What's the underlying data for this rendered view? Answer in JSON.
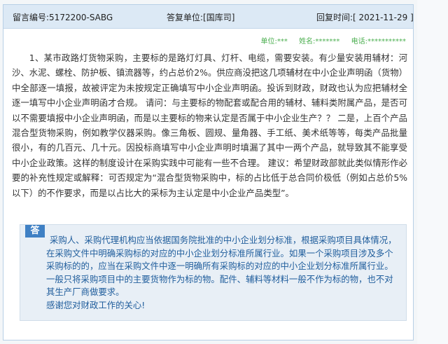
{
  "header": {
    "message_no": "留言编号:5172200-SABG",
    "reply_unit": "答复单位:[国库司]",
    "reply_time": "回复时间:[ 2021-11-29 ]"
  },
  "meta": {
    "unit": "单位:***",
    "name": "姓名:*******",
    "phone": "电话:***********"
  },
  "question": {
    "text": "1、某市政路灯货物采购，主要标的是路灯灯具、灯杆、电缆，需要安装。有少量安装用辅材：河沙、水泥、螺栓、防护板、镇流器等，约占总价2%。供应商没把这几项辅材在中小企业声明函（货物）中全部逐一填报，故被评定为未按规定正确填写中小企业声明函。投诉到财政，财政也认为应把辅材全逐一填写中小企业声明函才合规。 请问：与主要标的物配套或配合用的辅材、辅料类附属产品，是否可以不需要填报中小企业声明函，而是以主要标的物来认定是否属于中小企业生产？？ 二是，上百个产品混合型货物采购，例如教学仪器采购。像三角板、圆规、量角器、手工纸、美术纸等等，每类产品批量很小，有的几百元、几十元。因投标商填写中小企业声明时填漏了其中一两个产品，就导致其不能享受中小企业政策。这样的制度设计在采购实践中可能有一些不合理。 建议：希望财政部就此类似情形作必要的补充性规定或解释：可否规定为“混合型货物采购中，标的占比低于总合同价极低（例如占总价5%以下）的不作要求，而是以占比大的采标为主认定是中小企业产品类型”。"
  },
  "answer": {
    "badge": "答",
    "body": "采购人、采购代理机构应当依据国务院批准的中小企业划分标准，根据采购项目具体情况，在采购文件中明确采购标的对应的中小企业划分标准所属行业。如果一个采购项目涉及多个采购标的的，应当在采购文件中逐一明确所有采购标的对应的中小企业划分标准所属行业。一般只将采购项目中的主要货物作为标的物。配件、辅料等材料一般不作为标的物，也不对其生产厂商做要求。",
    "closing": "感谢您对财政工作的关心!"
  }
}
